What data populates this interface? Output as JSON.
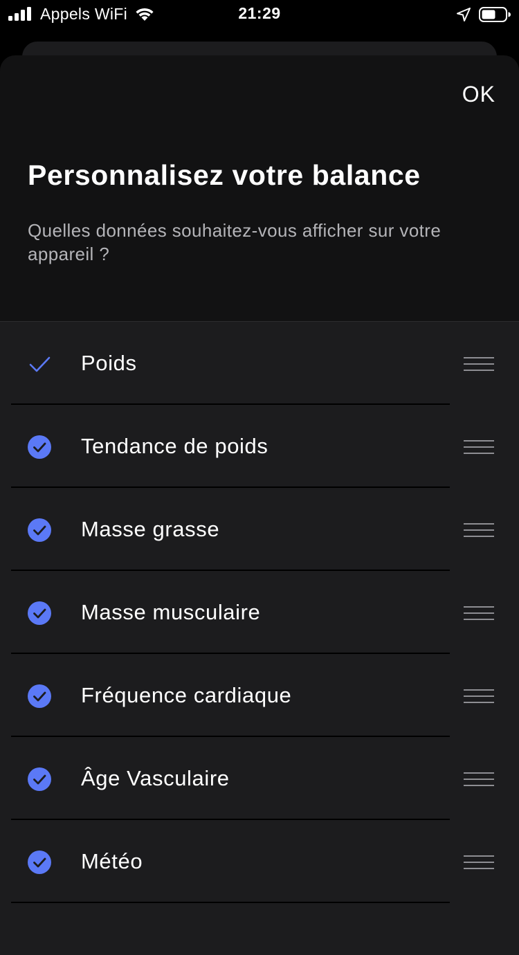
{
  "status_bar": {
    "carrier": "Appels WiFi",
    "time": "21:29"
  },
  "header": {
    "ok_label": "OK",
    "title": "Personnalisez votre balance",
    "subtitle": "Quelles données souhaitez-vous afficher sur votre appareil ?"
  },
  "items": [
    {
      "label": "Poids",
      "check_style": "plain"
    },
    {
      "label": "Tendance de poids",
      "check_style": "filled"
    },
    {
      "label": "Masse grasse",
      "check_style": "filled"
    },
    {
      "label": "Masse musculaire",
      "check_style": "filled"
    },
    {
      "label": "Fréquence cardiaque",
      "check_style": "filled"
    },
    {
      "label": "Âge Vasculaire",
      "check_style": "filled"
    },
    {
      "label": "Météo",
      "check_style": "filled"
    }
  ],
  "colors": {
    "accent": "#5b79f6",
    "background": "#000000",
    "sheet": "#121213",
    "list": "#1c1c1e",
    "handle": "#8e8e93"
  },
  "icons": {
    "signal": "signal-bars-icon",
    "wifi": "wifi-icon",
    "location": "location-arrow-icon",
    "battery": "battery-icon",
    "check": "checkmark-icon",
    "check_filled": "checkmark-circle-icon",
    "handle": "drag-handle-icon"
  }
}
